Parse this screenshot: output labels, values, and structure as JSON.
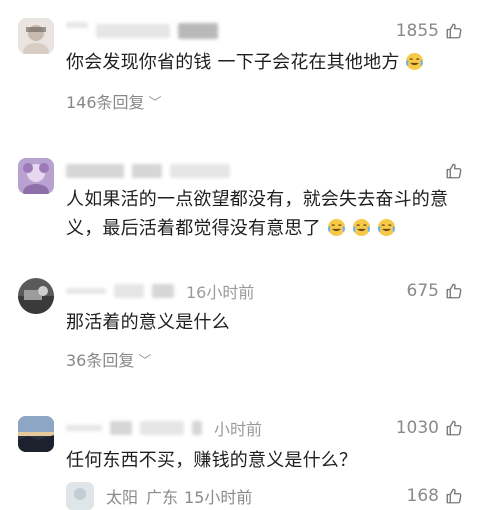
{
  "comments": [
    {
      "text": "你会发现你省的钱 一下子会花在其他地方",
      "emoji_count": 1,
      "likes": "1855",
      "replies": "146条回复",
      "time": ""
    },
    {
      "text_line1": "人如果活的一点欲望都没有，就会失去奋斗的意",
      "text_line2": "义，最后活着都觉得没有意思了",
      "emoji_count": 3,
      "likes": "",
      "time": ""
    },
    {
      "time": "16小时前",
      "likes": "675",
      "text": "那活着的意义是什么",
      "replies": "36条回复"
    },
    {
      "time": "小时前",
      "likes": "1030",
      "text": "任何东西不买，赚钱的意义是什么？"
    }
  ],
  "sub_reply": {
    "name": "太阳",
    "location": "广东",
    "time": "15小时前",
    "likes": "168"
  },
  "icons": {
    "like": "thumbs-up-icon",
    "emoji": "laughing-crying-emoji-icon",
    "chevron": "chevron-down-icon"
  },
  "colors": {
    "text": "#1f1f1f",
    "meta": "#999999",
    "background": "#ffffff"
  }
}
